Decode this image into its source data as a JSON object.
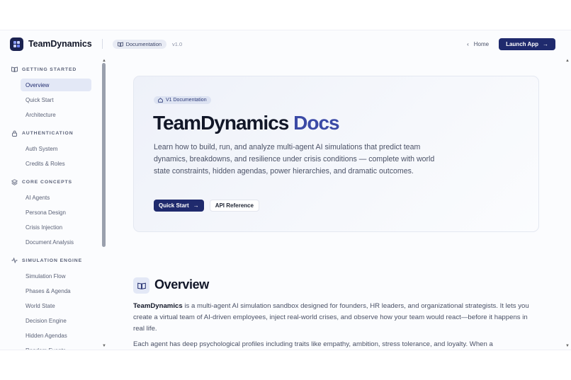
{
  "header": {
    "brand": "TeamDynamics",
    "doc_badge": "Documentation",
    "version": "v1.0",
    "home": "Home",
    "launch": "Launch App"
  },
  "sidebar": {
    "sections": [
      {
        "title": "GETTING STARTED",
        "icon": "book-icon",
        "items": [
          "Overview",
          "Quick Start",
          "Architecture"
        ]
      },
      {
        "title": "AUTHENTICATION",
        "icon": "lock-icon",
        "items": [
          "Auth System",
          "Credits & Roles"
        ]
      },
      {
        "title": "CORE CONCEPTS",
        "icon": "layers-icon",
        "items": [
          "AI Agents",
          "Persona Design",
          "Crisis Injection",
          "Document Analysis"
        ]
      },
      {
        "title": "SIMULATION ENGINE",
        "icon": "activity-icon",
        "items": [
          "Simulation Flow",
          "Phases & Agenda",
          "World State",
          "Decision Engine",
          "Hidden Agendas",
          "Random Events"
        ]
      }
    ],
    "active_item": "Overview"
  },
  "hero": {
    "badge": "V1 Documentation",
    "title_main": "TeamDynamics",
    "title_accent": "Docs",
    "description": "Learn how to build, run, and analyze multi-agent AI simulations that predict team dynamics, breakdowns, and resilience under crisis conditions — complete with world state constraints, hidden agendas, power hierarchies, and dramatic outcomes.",
    "primary_button": "Quick Start",
    "secondary_button": "API Reference"
  },
  "overview": {
    "title": "Overview",
    "p1_bold": "TeamDynamics",
    "p1_rest": " is a multi-agent AI simulation sandbox designed for founders, HR leaders, and organizational strategists. It lets you create a virtual team of AI-driven employees, inject real-world crises, and observe how your team would react—before it happens in real life.",
    "p2": "Each agent has deep psychological profiles including traits like empathy, ambition, stress tolerance, and loyalty. When a"
  },
  "colors": {
    "accent": "#1f2a6d",
    "accent_text": "#3b4aa6",
    "active_bg": "#e3e8f6"
  }
}
